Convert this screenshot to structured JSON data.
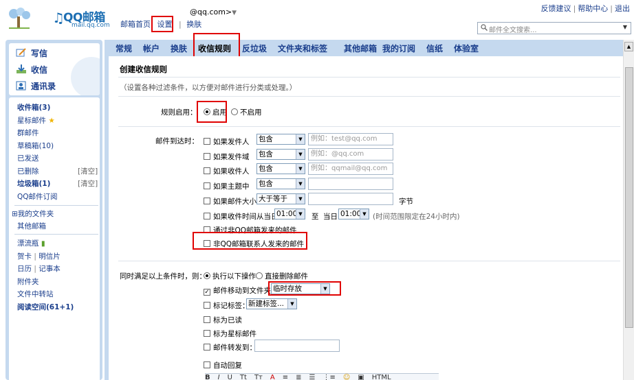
{
  "header": {
    "logo_text": "QQ邮箱",
    "logo_sub": "mail.qq.com",
    "account": "@qq.com>",
    "nav": [
      "邮箱首页",
      "设置",
      "换肤"
    ],
    "links": [
      "反馈建议",
      "帮助中心",
      "退出"
    ],
    "search_placeholder": "邮件全文搜索..."
  },
  "sidebar": {
    "buttons": [
      {
        "label": "写信",
        "icon": "pencil-icon"
      },
      {
        "label": "收信",
        "icon": "inbox-download-icon"
      },
      {
        "label": "通讯录",
        "icon": "address-book-icon"
      }
    ],
    "items": [
      {
        "label": "收件箱(3)",
        "bold": true
      },
      {
        "label": "星标邮件",
        "bold": false,
        "star": "★"
      },
      {
        "label": "群邮件",
        "bold": false
      },
      {
        "label": "草稿箱(10)",
        "bold": false
      },
      {
        "label": "已发送",
        "bold": false
      },
      {
        "label": "已删除",
        "bold": false,
        "clear": "[清空]"
      },
      {
        "label": "垃圾箱(1)",
        "bold": true,
        "clear": "[清空]"
      },
      {
        "label": "QQ邮件订阅",
        "bold": false
      }
    ],
    "folders": {
      "my_folders": "⊞我的文件夹",
      "other": "其他邮箱"
    },
    "tools": [
      {
        "label": "漂流瓶",
        "bold": false
      },
      {
        "label": "贺卡",
        "sep": "|",
        "label2": "明信片"
      },
      {
        "label": "日历",
        "sep": "|",
        "label2": "记事本"
      },
      {
        "label": "附件夹",
        "bold": false
      },
      {
        "label": "文件中转站",
        "bold": false
      },
      {
        "label": "阅读空间(61+1)",
        "bold": true
      }
    ]
  },
  "tabs": [
    "常规",
    "帐户",
    "换肤",
    "收信规则",
    "反垃圾",
    "文件夹和标签",
    "其他邮箱",
    "我的订阅",
    "信纸",
    "体验室"
  ],
  "active_tab": "收信规则",
  "rule": {
    "title": "创建收信规则",
    "desc": "（设置各种过滤条件，以方便对邮件进行分类或处理。）",
    "enable_label": "规则启用：",
    "enable_on": "启用",
    "enable_off": "不启用",
    "arrive_label": "邮件到达时：",
    "conditions": [
      {
        "label": "如果发件人",
        "select": "包含",
        "placeholder": "例如：test@qq.com"
      },
      {
        "label": "如果发件域",
        "select": "包含",
        "placeholder": "例如：@qq.com"
      },
      {
        "label": "如果收件人",
        "select": "包含",
        "placeholder": "例如：qqmail@qq.com"
      },
      {
        "label": "如果主题中",
        "select": "包含",
        "placeholder": ""
      },
      {
        "label": "如果邮件大小",
        "select": "大于等于",
        "placeholder": "",
        "unit": "字节"
      }
    ],
    "time": {
      "label": "如果收件时间从当日",
      "from": "01:00",
      "to_label": "至",
      "day_label": "当日",
      "to": "01:00",
      "note": "(时间范围限定在24小时内)"
    },
    "via_non_qq": "通过非QQ邮箱发来的邮件",
    "non_contact": "非QQ邮箱联系人发来的邮件",
    "action_label": "同时满足以上条件时，则：",
    "action_exec": "执行以下操作",
    "action_delete": "直接删除邮件",
    "actions": {
      "move": "邮件移动到文件夹",
      "move_folder": "临时存放",
      "tag": "标记标签：",
      "tag_select": "新建标签...",
      "read": "标为已读",
      "star": "标为星标邮件",
      "forward": "邮件转发到：",
      "auto_reply": "自动回复"
    },
    "toolbar": [
      "B",
      "I",
      "U",
      "Tt",
      "Tт",
      "A",
      "≡",
      "≣",
      "☰",
      "⋮≡",
      "☺",
      "▣",
      "HTML"
    ]
  },
  "colors": {
    "accent": "#1a3e8c",
    "panel": "#c5d9ef",
    "highlight": "#e00000"
  }
}
